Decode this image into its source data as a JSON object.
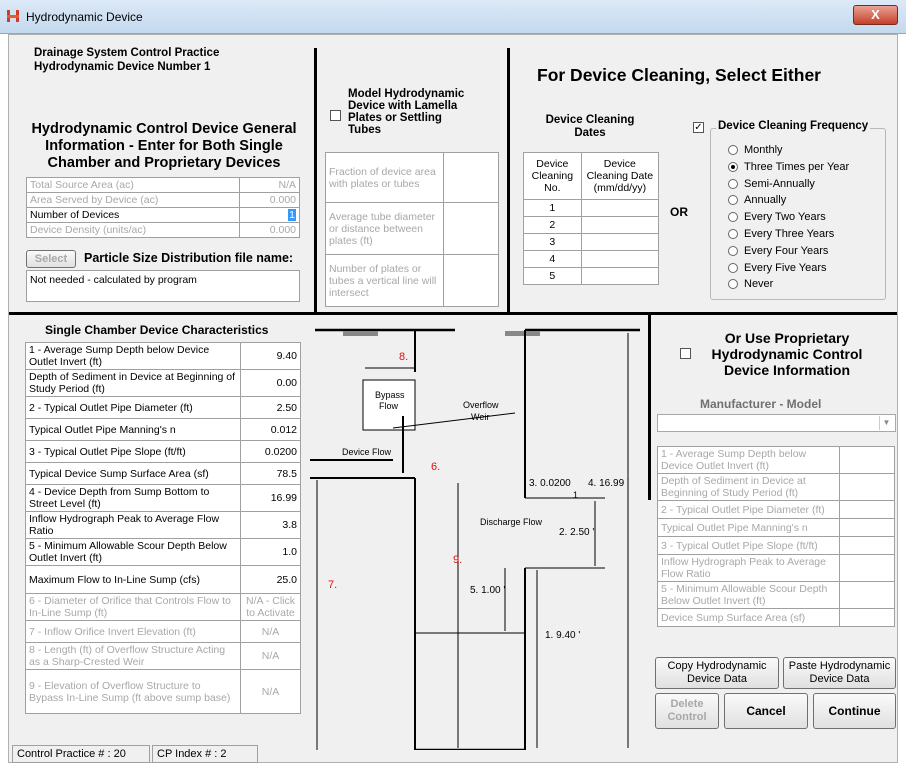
{
  "window": {
    "title": "Hydrodynamic Device",
    "close": "X"
  },
  "header": {
    "line1": "Drainage System Control Practice",
    "line2": "Hydrodynamic Device Number 1"
  },
  "general": {
    "title": "Hydrodynamic Control Device General Information - Enter for Both Single Chamber and Proprietary Devices",
    "rows": [
      {
        "label": "Total Source Area (ac)",
        "value": "N/A"
      },
      {
        "label": "Area Served by Device (ac)",
        "value": "0.000"
      },
      {
        "label": "Number of Devices",
        "value": "1"
      },
      {
        "label": "Device Density (units/ac)",
        "value": "0.000"
      }
    ],
    "select_label": "Select",
    "psd_label": "Particle Size Distribution file name:",
    "psd_value": "Not needed - calculated by program"
  },
  "lamella": {
    "title": "Model Hydrodynamic Device with Lamella Plates or Settling Tubes",
    "checked": false,
    "rows": [
      "Fraction of device area with plates or tubes",
      "Average tube diameter or distance between plates (ft)",
      "Number of plates or tubes a vertical line will intersect"
    ]
  },
  "cleaning": {
    "heading": "For Device Cleaning, Select Either",
    "dates_title": "Device Cleaning Dates",
    "col1": "Device Cleaning No.",
    "col2": "Device Cleaning Date (mm/dd/yy)",
    "numbers": [
      "1",
      "2",
      "3",
      "4",
      "5"
    ],
    "or": "OR",
    "freq_label": "Device Cleaning Frequency",
    "freq_checked": true,
    "options": [
      "Monthly",
      "Three Times per Year",
      "Semi-Annually",
      "Annually",
      "Every Two Years",
      "Every Three Years",
      "Every Four Years",
      "Every Five Years",
      "Never"
    ],
    "selected": "Three Times per Year"
  },
  "single": {
    "title": "Single Chamber Device Characteristics",
    "rows": [
      {
        "label": "1 - Average Sump Depth below Device Outlet Invert (ft)",
        "value": "9.40"
      },
      {
        "label": "Depth of Sediment in Device at Beginning of Study Period (ft)",
        "value": "0.00"
      },
      {
        "label": "2 - Typical Outlet Pipe Diameter (ft)",
        "value": "2.50"
      },
      {
        "label": "Typical Outlet Pipe Manning's n",
        "value": "0.012"
      },
      {
        "label": "3 - Typical Outlet Pipe Slope (ft/ft)",
        "value": "0.0200"
      },
      {
        "label": "Typical Device Sump Surface Area (sf)",
        "value": "78.5"
      },
      {
        "label": "4 - Device Depth from Sump Bottom to Street Level (ft)",
        "value": "16.99"
      },
      {
        "label": "Inflow Hydrograph Peak to Average Flow Ratio",
        "value": "3.8"
      },
      {
        "label": "5 - Minimum Allowable Scour Depth Below Outlet Invert (ft)",
        "value": "1.0"
      },
      {
        "label": "Maximum Flow to In-Line Sump (cfs)",
        "value": "25.0"
      },
      {
        "label": "6 - Diameter of Orifice that Controls Flow to In-Line Sump (ft)",
        "value": "N/A - Click to Activate"
      },
      {
        "label": "7 - Inflow Orifice Invert Elevation (ft)",
        "value": "N/A"
      },
      {
        "label": "8 - Length (ft) of Overflow Structure Acting as a Sharp-Crested Weir",
        "value": "N/A"
      },
      {
        "label": "9 - Elevation of Overflow Structure to Bypass In-Line Sump (ft above sump base)",
        "value": "N/A"
      }
    ]
  },
  "diagram": {
    "bypass": "Bypass Flow",
    "overflow": "Overflow Weir",
    "device_flow": "Device Flow",
    "discharge": "Discharge Flow",
    "n8": "8.",
    "n6": "6.",
    "n9": "9.",
    "n7": "7.",
    "d3": "3.  0.0200",
    "d4": "4.  16.99 '",
    "d2": "2.  2.50 '",
    "d5": "5.  1.00 '",
    "d1": "1.  9.40 '",
    "one": "1"
  },
  "proprietary": {
    "title": "Or Use Proprietary Hydrodynamic Control Device Information",
    "checked": false,
    "mm_label": "Manufacturer - Model",
    "rows": [
      "1 - Average Sump Depth below Device Outlet Invert (ft)",
      "Depth of Sediment in Device at Beginning of Study Period (ft)",
      "2 - Typical Outlet Pipe Diameter (ft)",
      "Typical Outlet Pipe Manning's n",
      "3 - Typical Outlet Pipe Slope (ft/ft)",
      "Inflow Hydrograph Peak to Average Flow Ratio",
      "5 - Minimum Allowable Scour Depth Below Outlet Invert (ft)",
      "Device Sump Surface Area (sf)"
    ]
  },
  "buttons": {
    "copy": "Copy Hydrodynamic Device Data",
    "paste": "Paste Hydrodynamic Device Data",
    "delete": "Delete Control",
    "cancel": "Cancel",
    "continue": "Continue"
  },
  "status": {
    "cp": "Control Practice # :  20",
    "index": "CP Index # :  2"
  }
}
